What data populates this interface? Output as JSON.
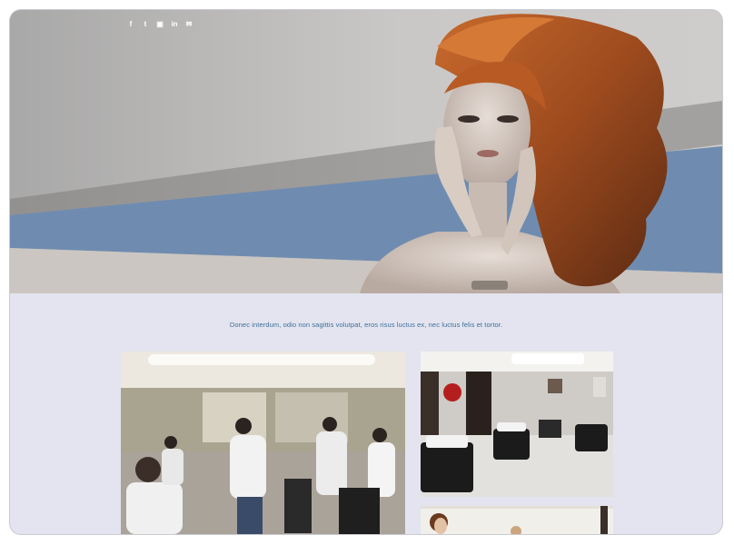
{
  "hero": {
    "social_icons": [
      {
        "name": "facebook-icon",
        "glyph": "f"
      },
      {
        "name": "twitter-icon",
        "glyph": "t"
      },
      {
        "name": "instagram-icon",
        "glyph": "▣"
      },
      {
        "name": "linkedin-icon",
        "glyph": "in"
      },
      {
        "name": "email-icon",
        "glyph": "✉"
      }
    ],
    "image": "woman-with-red-curly-hair"
  },
  "main": {
    "tagline": "Donec interdum, odio non sagittis volutpat, eros risus luctus ex, nec luctus felis et tortor."
  },
  "gallery": [
    {
      "image": "salon-interior-busy"
    },
    {
      "image": "salon-interior-chairs"
    },
    {
      "image": "salon-staff-partial"
    }
  ],
  "colors": {
    "page_background": "#e3e4ef",
    "hero_grey": "#b9b8b7",
    "hero_blue": "#6f8cb0",
    "tagline_text": "#3d6f9a"
  }
}
